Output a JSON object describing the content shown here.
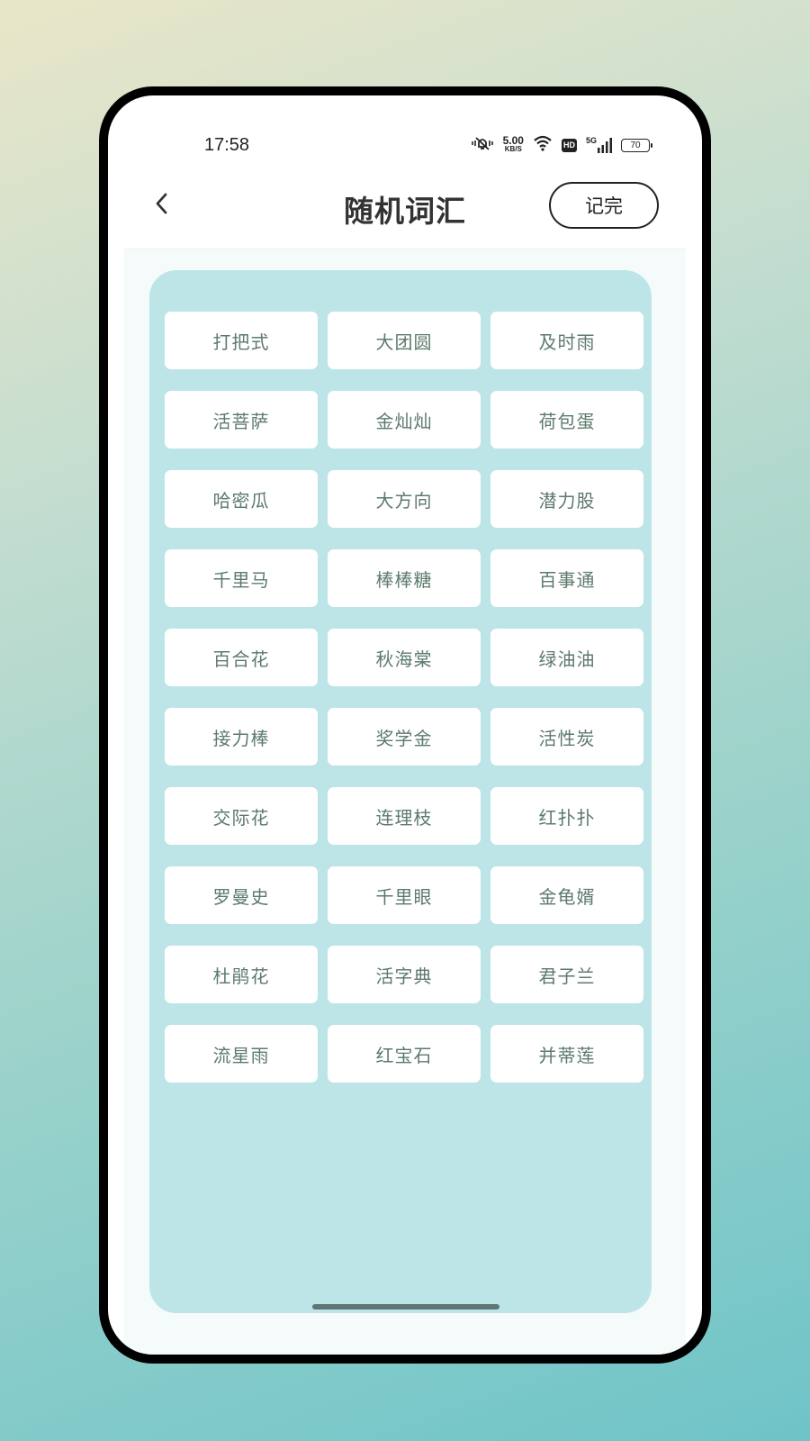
{
  "status_bar": {
    "time": "17:58",
    "net_speed_value": "5.00",
    "net_speed_unit": "KB/S",
    "hd_label": "HD",
    "signal_label": "5G",
    "battery_level": "70",
    "icons": [
      "vibrate-mute-icon",
      "wifi-icon",
      "hd-icon",
      "signal-5g-icon",
      "battery-icon"
    ]
  },
  "header": {
    "back_icon": "chevron-left-icon",
    "title": "随机词汇",
    "done_label": "记完"
  },
  "words": [
    [
      "打把式",
      "大团圆",
      "及时雨"
    ],
    [
      "活菩萨",
      "金灿灿",
      "荷包蛋"
    ],
    [
      "哈密瓜",
      "大方向",
      "潜力股"
    ],
    [
      "千里马",
      "棒棒糖",
      "百事通"
    ],
    [
      "百合花",
      "秋海棠",
      "绿油油"
    ],
    [
      "接力棒",
      "奖学金",
      "活性炭"
    ],
    [
      "交际花",
      "连理枝",
      "红扑扑"
    ],
    [
      "罗曼史",
      "千里眼",
      "金龟婿"
    ],
    [
      "杜鹃花",
      "活字典",
      "君子兰"
    ],
    [
      "流星雨",
      "红宝石",
      "并蒂莲"
    ]
  ],
  "colors": {
    "panel_background": "#bde5e8",
    "word_text": "#5d7a6c",
    "content_background": "#f4fbfa"
  }
}
